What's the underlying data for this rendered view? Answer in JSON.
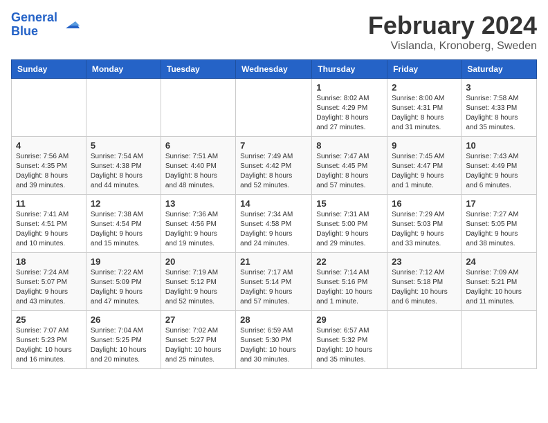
{
  "header": {
    "logo_line1": "General",
    "logo_line2": "Blue",
    "month": "February 2024",
    "location": "Vislanda, Kronoberg, Sweden"
  },
  "weekdays": [
    "Sunday",
    "Monday",
    "Tuesday",
    "Wednesday",
    "Thursday",
    "Friday",
    "Saturday"
  ],
  "weeks": [
    [
      {
        "day": "",
        "info": ""
      },
      {
        "day": "",
        "info": ""
      },
      {
        "day": "",
        "info": ""
      },
      {
        "day": "",
        "info": ""
      },
      {
        "day": "1",
        "info": "Sunrise: 8:02 AM\nSunset: 4:29 PM\nDaylight: 8 hours\nand 27 minutes."
      },
      {
        "day": "2",
        "info": "Sunrise: 8:00 AM\nSunset: 4:31 PM\nDaylight: 8 hours\nand 31 minutes."
      },
      {
        "day": "3",
        "info": "Sunrise: 7:58 AM\nSunset: 4:33 PM\nDaylight: 8 hours\nand 35 minutes."
      }
    ],
    [
      {
        "day": "4",
        "info": "Sunrise: 7:56 AM\nSunset: 4:35 PM\nDaylight: 8 hours\nand 39 minutes."
      },
      {
        "day": "5",
        "info": "Sunrise: 7:54 AM\nSunset: 4:38 PM\nDaylight: 8 hours\nand 44 minutes."
      },
      {
        "day": "6",
        "info": "Sunrise: 7:51 AM\nSunset: 4:40 PM\nDaylight: 8 hours\nand 48 minutes."
      },
      {
        "day": "7",
        "info": "Sunrise: 7:49 AM\nSunset: 4:42 PM\nDaylight: 8 hours\nand 52 minutes."
      },
      {
        "day": "8",
        "info": "Sunrise: 7:47 AM\nSunset: 4:45 PM\nDaylight: 8 hours\nand 57 minutes."
      },
      {
        "day": "9",
        "info": "Sunrise: 7:45 AM\nSunset: 4:47 PM\nDaylight: 9 hours\nand 1 minute."
      },
      {
        "day": "10",
        "info": "Sunrise: 7:43 AM\nSunset: 4:49 PM\nDaylight: 9 hours\nand 6 minutes."
      }
    ],
    [
      {
        "day": "11",
        "info": "Sunrise: 7:41 AM\nSunset: 4:51 PM\nDaylight: 9 hours\nand 10 minutes."
      },
      {
        "day": "12",
        "info": "Sunrise: 7:38 AM\nSunset: 4:54 PM\nDaylight: 9 hours\nand 15 minutes."
      },
      {
        "day": "13",
        "info": "Sunrise: 7:36 AM\nSunset: 4:56 PM\nDaylight: 9 hours\nand 19 minutes."
      },
      {
        "day": "14",
        "info": "Sunrise: 7:34 AM\nSunset: 4:58 PM\nDaylight: 9 hours\nand 24 minutes."
      },
      {
        "day": "15",
        "info": "Sunrise: 7:31 AM\nSunset: 5:00 PM\nDaylight: 9 hours\nand 29 minutes."
      },
      {
        "day": "16",
        "info": "Sunrise: 7:29 AM\nSunset: 5:03 PM\nDaylight: 9 hours\nand 33 minutes."
      },
      {
        "day": "17",
        "info": "Sunrise: 7:27 AM\nSunset: 5:05 PM\nDaylight: 9 hours\nand 38 minutes."
      }
    ],
    [
      {
        "day": "18",
        "info": "Sunrise: 7:24 AM\nSunset: 5:07 PM\nDaylight: 9 hours\nand 43 minutes."
      },
      {
        "day": "19",
        "info": "Sunrise: 7:22 AM\nSunset: 5:09 PM\nDaylight: 9 hours\nand 47 minutes."
      },
      {
        "day": "20",
        "info": "Sunrise: 7:19 AM\nSunset: 5:12 PM\nDaylight: 9 hours\nand 52 minutes."
      },
      {
        "day": "21",
        "info": "Sunrise: 7:17 AM\nSunset: 5:14 PM\nDaylight: 9 hours\nand 57 minutes."
      },
      {
        "day": "22",
        "info": "Sunrise: 7:14 AM\nSunset: 5:16 PM\nDaylight: 10 hours\nand 1 minute."
      },
      {
        "day": "23",
        "info": "Sunrise: 7:12 AM\nSunset: 5:18 PM\nDaylight: 10 hours\nand 6 minutes."
      },
      {
        "day": "24",
        "info": "Sunrise: 7:09 AM\nSunset: 5:21 PM\nDaylight: 10 hours\nand 11 minutes."
      }
    ],
    [
      {
        "day": "25",
        "info": "Sunrise: 7:07 AM\nSunset: 5:23 PM\nDaylight: 10 hours\nand 16 minutes."
      },
      {
        "day": "26",
        "info": "Sunrise: 7:04 AM\nSunset: 5:25 PM\nDaylight: 10 hours\nand 20 minutes."
      },
      {
        "day": "27",
        "info": "Sunrise: 7:02 AM\nSunset: 5:27 PM\nDaylight: 10 hours\nand 25 minutes."
      },
      {
        "day": "28",
        "info": "Sunrise: 6:59 AM\nSunset: 5:30 PM\nDaylight: 10 hours\nand 30 minutes."
      },
      {
        "day": "29",
        "info": "Sunrise: 6:57 AM\nSunset: 5:32 PM\nDaylight: 10 hours\nand 35 minutes."
      },
      {
        "day": "",
        "info": ""
      },
      {
        "day": "",
        "info": ""
      }
    ]
  ]
}
